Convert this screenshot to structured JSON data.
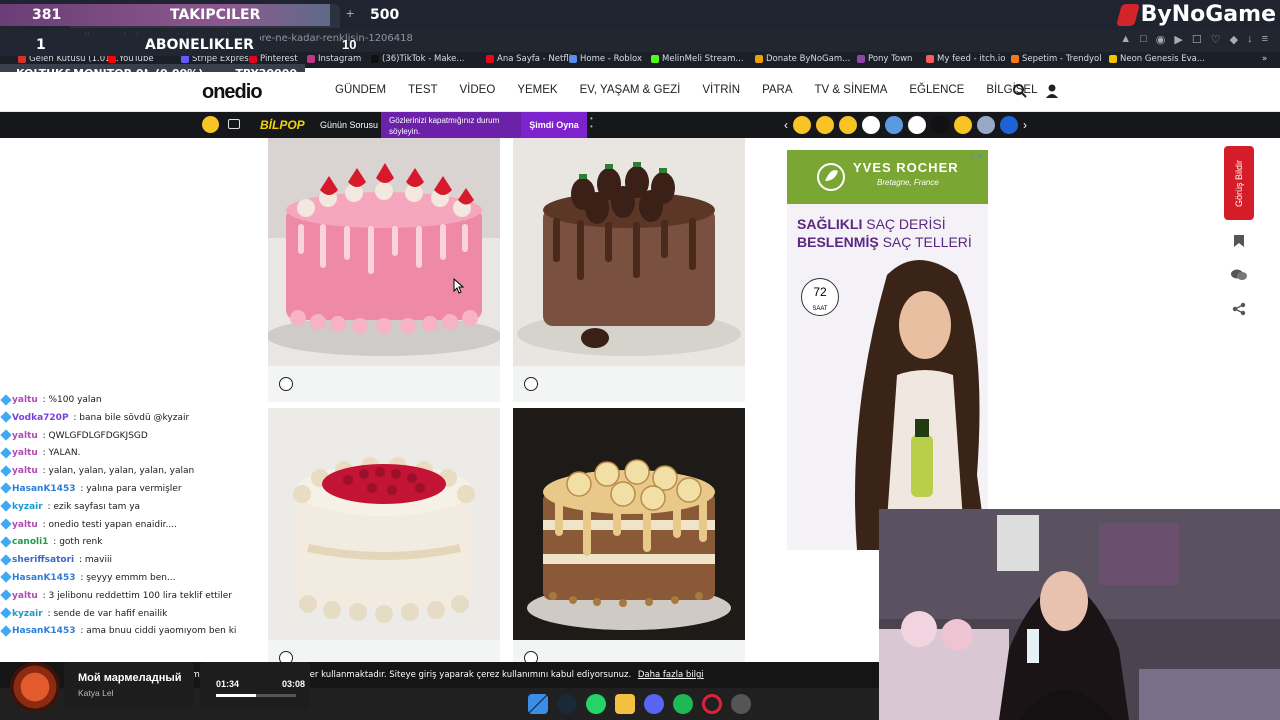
{
  "browser": {
    "url": "onedio.com/haber/sectigin-pastalara-gore-ne-kadar-renklisin-1206418",
    "bookmarks": [
      {
        "label": "Gelen Kutusu (1.01...",
        "color": "#d93025"
      },
      {
        "label": "YouTube",
        "color": "#ff0000"
      },
      {
        "label": "Stripe Express",
        "color": "#635bff"
      },
      {
        "label": "Pinterest",
        "color": "#e60023"
      },
      {
        "label": "Instagram",
        "color": "#c13584"
      },
      {
        "label": "(36)TikTok - Make...",
        "color": "#111111"
      },
      {
        "label": "Ana Sayfa - Netflix",
        "color": "#e50914"
      },
      {
        "label": "Home - Roblox",
        "color": "#5a8dee"
      },
      {
        "label": "MelinMeli Stream...",
        "color": "#53fc18"
      },
      {
        "label": "Donate ByNoGam...",
        "color": "#f0a000"
      },
      {
        "label": "Pony Town",
        "color": "#8e44ad"
      },
      {
        "label": "My feed - itch.io",
        "color": "#fa5c5c"
      },
      {
        "label": "Sepetim - Trendyol",
        "color": "#f27a1a"
      },
      {
        "label": "Neon Genesis Eva...",
        "color": "#f5c400"
      }
    ]
  },
  "overlay": {
    "followers_count": "381",
    "followers_label": "TAKIPCILER",
    "followers_goal": "500",
    "subs_count": "1",
    "subs_label": "ABONELIKLER",
    "subs_goal": "10",
    "donation_label": "KOLTUK&MONITOR 0₺ (0.00%)",
    "donation_value": "TRY20000",
    "brand": "ByNoGame"
  },
  "site": {
    "logo": "onedio",
    "nav": [
      "GÜNDEM",
      "TEST",
      "VİDEO",
      "YEMEK",
      "EV, YAŞAM & GEZİ",
      "VİTRİN",
      "PARA",
      "TV & SİNEMA",
      "EĞLENCE",
      "BİLGİSEL"
    ],
    "bilpop": "BİLPOP",
    "gunun_sorusu": "Günün Sorusu",
    "promo_text": "Gözlerinizi kapatmığınız durum söyleyin.",
    "play_now": "Şimdi Oyna",
    "feedback_label": "Görüş Bildir",
    "emoji_colors": [
      "#f7c325",
      "#f7c325",
      "#f7c325",
      "#ffffff",
      "#5c9ae0",
      "#ffffff",
      "#111111",
      "#f7c325",
      "#9aa8c8",
      "#1e63d6"
    ]
  },
  "ad": {
    "brand": "YVES ROCHER",
    "brand_sub": "Bretagne, France",
    "line1_bold": "SAĞLIKLI",
    "line1_rest": " SAÇ DERİSİ",
    "line2_bold": "BESLENMİŞ",
    "line2_rest": " SAÇ TELLERİ",
    "badge": "72",
    "badge_unit": "SAAT"
  },
  "chat": [
    {
      "user": "yaltu",
      "msg": " : %100 yalan",
      "color": "#b04ab8"
    },
    {
      "user": "Vodka720P",
      "msg": " : bana bile sövdü @kyzair",
      "color": "#7b3fe4"
    },
    {
      "user": "yaltu",
      "msg": " : QWLGFDLGFDGKJSGD",
      "color": "#b04ab8"
    },
    {
      "user": "yaltu",
      "msg": " : YALAN.",
      "color": "#b04ab8"
    },
    {
      "user": "yaltu",
      "msg": " : yalan, yalan, yalan, yalan, yalan",
      "color": "#b04ab8"
    },
    {
      "user": "HasanK1453",
      "msg": " : yalına para vermişler",
      "color": "#2b7fd8"
    },
    {
      "user": "kyzair",
      "msg": " : ezik sayfası tam ya",
      "color": "#1c9acb"
    },
    {
      "user": "yaltu",
      "msg": " : onedio testi yapan enaidir....",
      "color": "#b04ab8"
    },
    {
      "user": "canoli1",
      "msg": " : goth renk",
      "color": "#1f9b4f"
    },
    {
      "user": "sheriffsatori",
      "msg": " : maviii",
      "color": "#3a67c7"
    },
    {
      "user": "HasanK1453",
      "msg": " : şeyyy emmm ben...",
      "color": "#2b7fd8"
    },
    {
      "user": "yaltu",
      "msg": " : 3 jelibonu reddettim 100 lira teklif ettiler",
      "color": "#b04ab8"
    },
    {
      "user": "kyzair",
      "msg": " : sende de var hafif enailik",
      "color": "#1c9acb"
    },
    {
      "user": "HasanK1453",
      "msg": " : ama bnuu ciddi yaomıyom ben ki",
      "color": "#2b7fd8"
    }
  ],
  "cookie": {
    "text": "Sitemiz en iyi hizmet için çerezler kullanmaktadır. Siteye giriş yaparak çerez kullanımını kabul ediyorsunuz.",
    "link": "Daha fazla bilgi"
  },
  "music": {
    "title": "Мой мармеладный",
    "artist": "Katya Lel",
    "elapsed": "01:34",
    "total": "03:08",
    "progress": 0.5
  },
  "taskbar_icons": [
    "windows-icon",
    "steam-icon",
    "whatsapp-icon",
    "files-icon",
    "discord-icon",
    "spotify-icon",
    "opera-gx-icon",
    "settings-icon"
  ]
}
